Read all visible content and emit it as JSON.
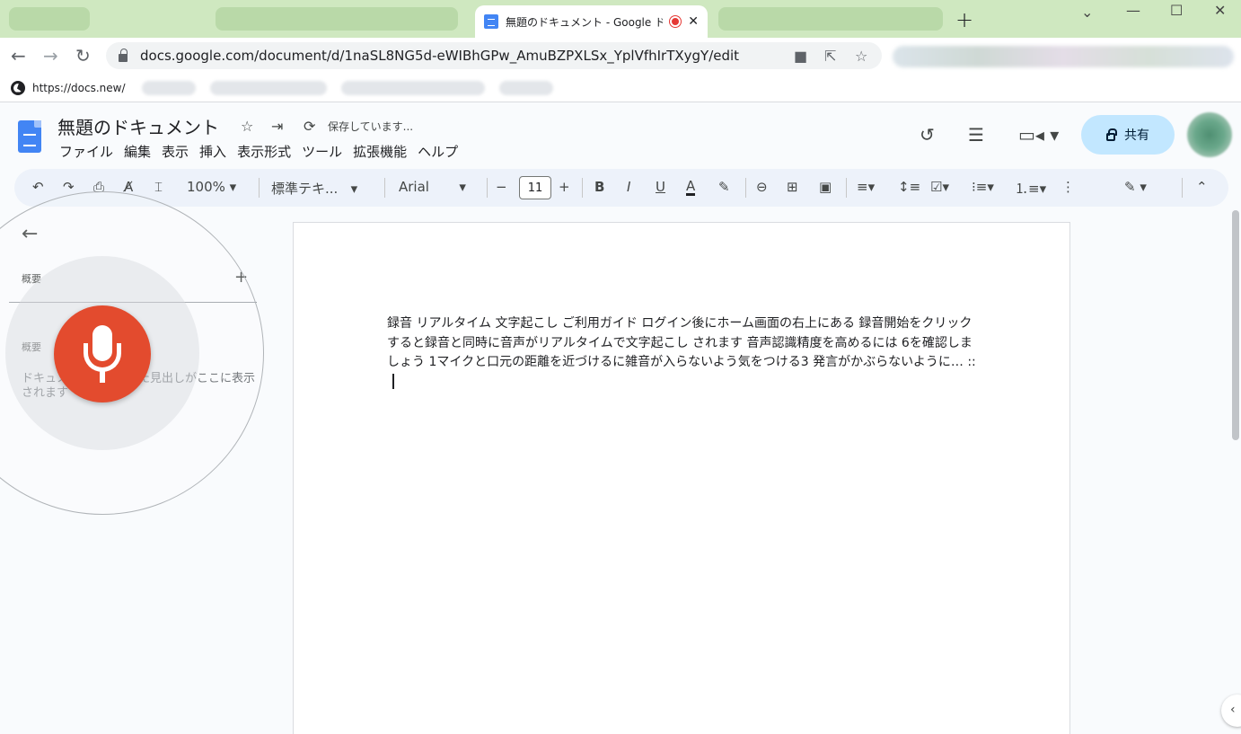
{
  "browser": {
    "tab_title": "無題のドキュメント - Google ドキ",
    "new_tab_symbol": "+",
    "url": "docs.google.com/document/d/1naSL8NG5d-eWIBhGPw_AmuBZPXLSx_YplVfhIrTXygY/edit",
    "bookmark": "https://docs.new/"
  },
  "docs": {
    "title": "無題のドキュメント",
    "save_status": "保存しています...",
    "menu": [
      "ファイル",
      "編集",
      "表示",
      "挿入",
      "表示形式",
      "ツール",
      "拡張機能",
      "ヘルプ"
    ],
    "share_label": "共有"
  },
  "toolbar": {
    "zoom": "100%",
    "style": "標準テキ...",
    "font": "Arial",
    "font_size": "11"
  },
  "outline": {
    "heading1": "概要",
    "heading2": "概要",
    "hint": "ドキュメントに追加した見出しがここに表示されます"
  },
  "document": {
    "body": "録音 リアルタイム 文字起こし ご利用ガイド ログイン後にホーム画面の右上にある 録音開始をクリックすると録音と同時に音声がリアルタイムで文字起こし されます 音声認識精度を高めるには 6を確認しましょう 1マイクと口元の距離を近づけるに雑音が入らないよう気をつける3 発言がかぶらないように… ::"
  },
  "colors": {
    "tabstrip": "#cfe8c0",
    "share_bg": "#c2e7ff",
    "mic_red": "#e34b2e",
    "docs_blue": "#4285f4"
  }
}
